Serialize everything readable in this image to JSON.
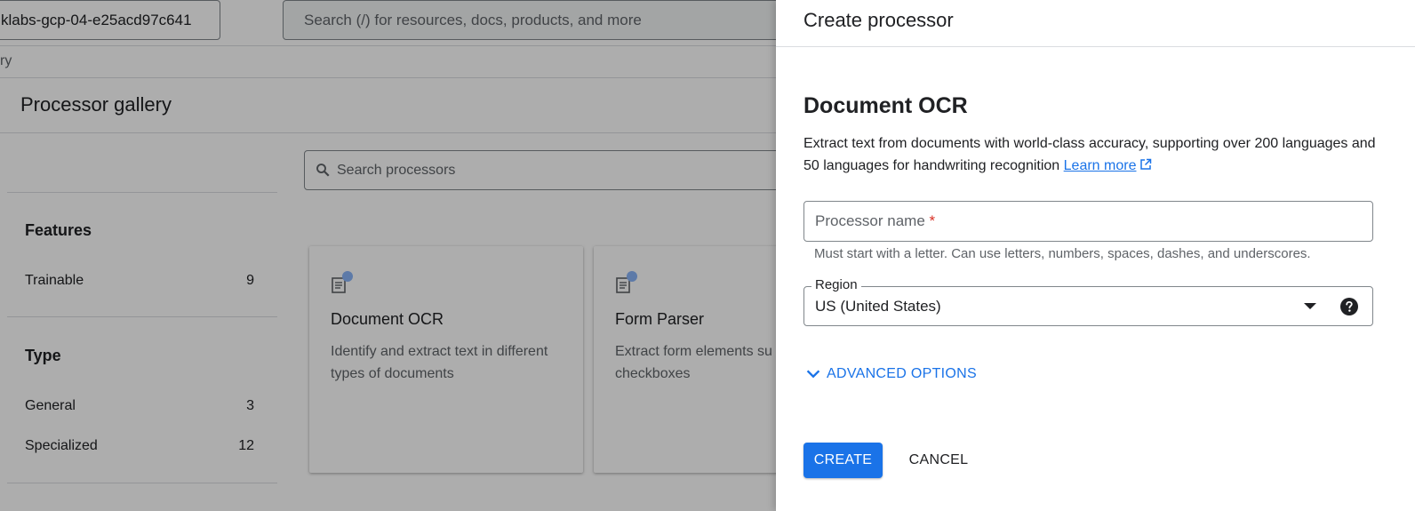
{
  "header": {
    "project_name": "klabs-gcp-04-e25acd97c641",
    "search_placeholder": "Search (/) for resources, docs, products, and more"
  },
  "breadcrumb": "ry",
  "page_title": "Processor gallery",
  "filters": {
    "features_heading": "Features",
    "features": [
      {
        "label": "Trainable",
        "count": "9"
      }
    ],
    "type_heading": "Type",
    "types": [
      {
        "label": "General",
        "count": "3"
      },
      {
        "label": "Specialized",
        "count": "12"
      }
    ]
  },
  "processor_search_placeholder": "Search processors",
  "cards": [
    {
      "title": "Document OCR",
      "description": "Identify and extract text in different types of documents"
    },
    {
      "title": "Form Parser",
      "description": "Extract form elements su and checkboxes"
    }
  ],
  "panel": {
    "title": "Create processor",
    "processor_heading": "Document OCR",
    "description": "Extract text from documents with world-class accuracy, supporting over 200 languages and 50 languages for handwriting recognition",
    "learn_more": "Learn more",
    "name_label": "Processor name",
    "required_marker": "*",
    "name_hint": "Must start with a letter. Can use letters, numbers, spaces, dashes, and underscores.",
    "region_label": "Region",
    "region_value": "US (United States)",
    "advanced_options": "ADVANCED OPTIONS",
    "create_button": "CREATE",
    "cancel_button": "CANCEL"
  },
  "colors": {
    "accent": "#1a73e8",
    "required": "#d93025",
    "scrim": "rgba(0,0,0,0.32)"
  },
  "icons": [
    "search-icon",
    "document-icon",
    "external-link-icon",
    "dropdown-arrow-icon",
    "help-icon",
    "chevron-down-icon"
  ]
}
